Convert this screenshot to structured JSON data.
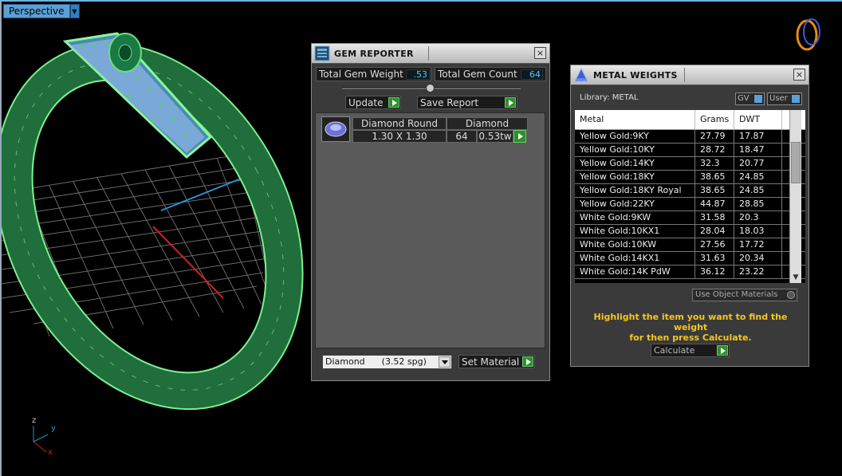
{
  "viewport": {
    "tab_label": "Perspective",
    "axes": {
      "z": "z",
      "y": "y",
      "x": "x"
    }
  },
  "gem_reporter": {
    "title": "GEM REPORTER",
    "total_weight_label": "Total Gem Weight",
    "total_weight_value": ".53",
    "total_count_label": "Total Gem Count",
    "total_count_value": "64",
    "update_label": "Update",
    "save_report_label": "Save Report",
    "row": {
      "shape_header": "Diamond Round",
      "shape_size": "1.30 X 1.30",
      "material_header": "Diamond",
      "count": "64",
      "weight": "0.53tw"
    },
    "material_select": "Diamond      (3.52 spg)",
    "set_material_label": "Set Material"
  },
  "metal_weights": {
    "title": "METAL WEIGHTS",
    "library_label": "Library: METAL",
    "toggle_gv": "GV",
    "toggle_user": "User",
    "columns": [
      "Metal",
      "Grams",
      "DWT"
    ],
    "rows": [
      [
        "Yellow Gold:9KY",
        "27.79",
        "17.87"
      ],
      [
        "Yellow Gold:10KY",
        "28.72",
        "18.47"
      ],
      [
        "Yellow Gold:14KY",
        "32.3",
        "20.77"
      ],
      [
        "Yellow Gold:18KY",
        "38.65",
        "24.85"
      ],
      [
        "Yellow Gold:18KY Royal",
        "38.65",
        "24.85"
      ],
      [
        "Yellow Gold:22KY",
        "44.87",
        "28.85"
      ],
      [
        "White Gold:9KW",
        "31.58",
        "20.3"
      ],
      [
        "White Gold:10KX1",
        "28.04",
        "18.03"
      ],
      [
        "White Gold:10KW",
        "27.56",
        "17.72"
      ],
      [
        "White Gold:14KX1",
        "31.63",
        "20.34"
      ],
      [
        "White Gold:14K PdW",
        "36.12",
        "23.22"
      ]
    ],
    "use_object_materials_label": "Use Object Materials",
    "hint_line1": "Highlight the item you want to find the weight",
    "hint_line2": "for then press Calculate.",
    "calculate_label": "Calculate"
  }
}
